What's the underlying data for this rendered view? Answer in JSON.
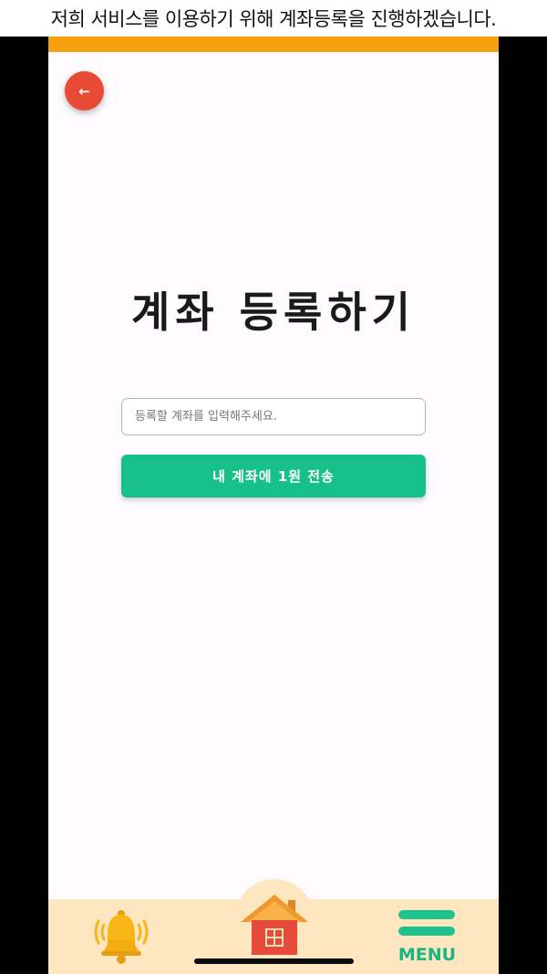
{
  "caption": "저희 서비스를 이용하기 위해 계좌등록을 진행하겠습니다.",
  "header": {
    "back_icon": "arrow-left-icon",
    "back_glyph": "←"
  },
  "main": {
    "title": "계좌 등록하기",
    "account_input": {
      "value": "",
      "placeholder": "등록할 계좌를 입력해주세요."
    },
    "send_button": "내 계좌에 1원 전송"
  },
  "bottom_nav": {
    "bell_icon": "bell-icon",
    "home_icon": "home-icon",
    "menu_icon": "menu-icon",
    "menu_label": "MENU"
  },
  "colors": {
    "accent_orange": "#f5a00d",
    "back_button": "#e94a35",
    "primary_green": "#17c089",
    "nav_background": "#fde6c0",
    "bell": "#f7b516",
    "house_roof": "#f0982e",
    "house_wall": "#e54a3a"
  }
}
